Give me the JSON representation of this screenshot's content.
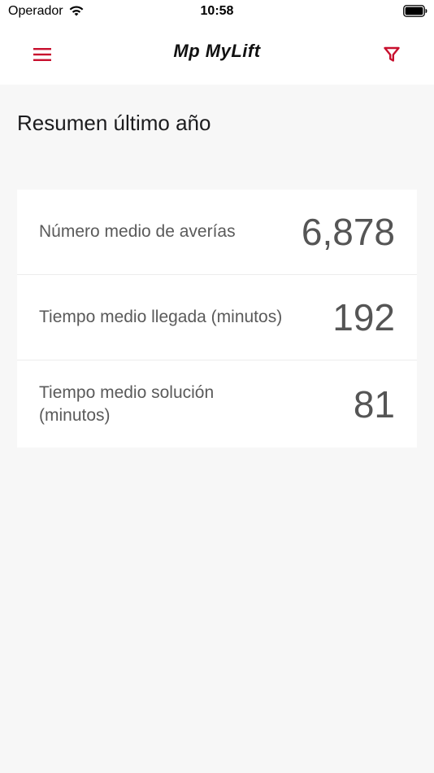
{
  "status_bar": {
    "carrier": "Operador",
    "time": "10:58"
  },
  "header": {
    "logo_text": "Mp MyLift",
    "menu_icon": "hamburger-menu-icon",
    "filter_icon": "filter-funnel-icon",
    "accent_color": "#c8102e"
  },
  "summary": {
    "title": "Resumen último año",
    "stats": [
      {
        "label": "Número medio de averías",
        "value": "6,878"
      },
      {
        "label": "Tiempo medio llegada (minutos)",
        "value": "192"
      },
      {
        "label": "Tiempo medio solución (minutos)",
        "value": "81"
      }
    ]
  }
}
